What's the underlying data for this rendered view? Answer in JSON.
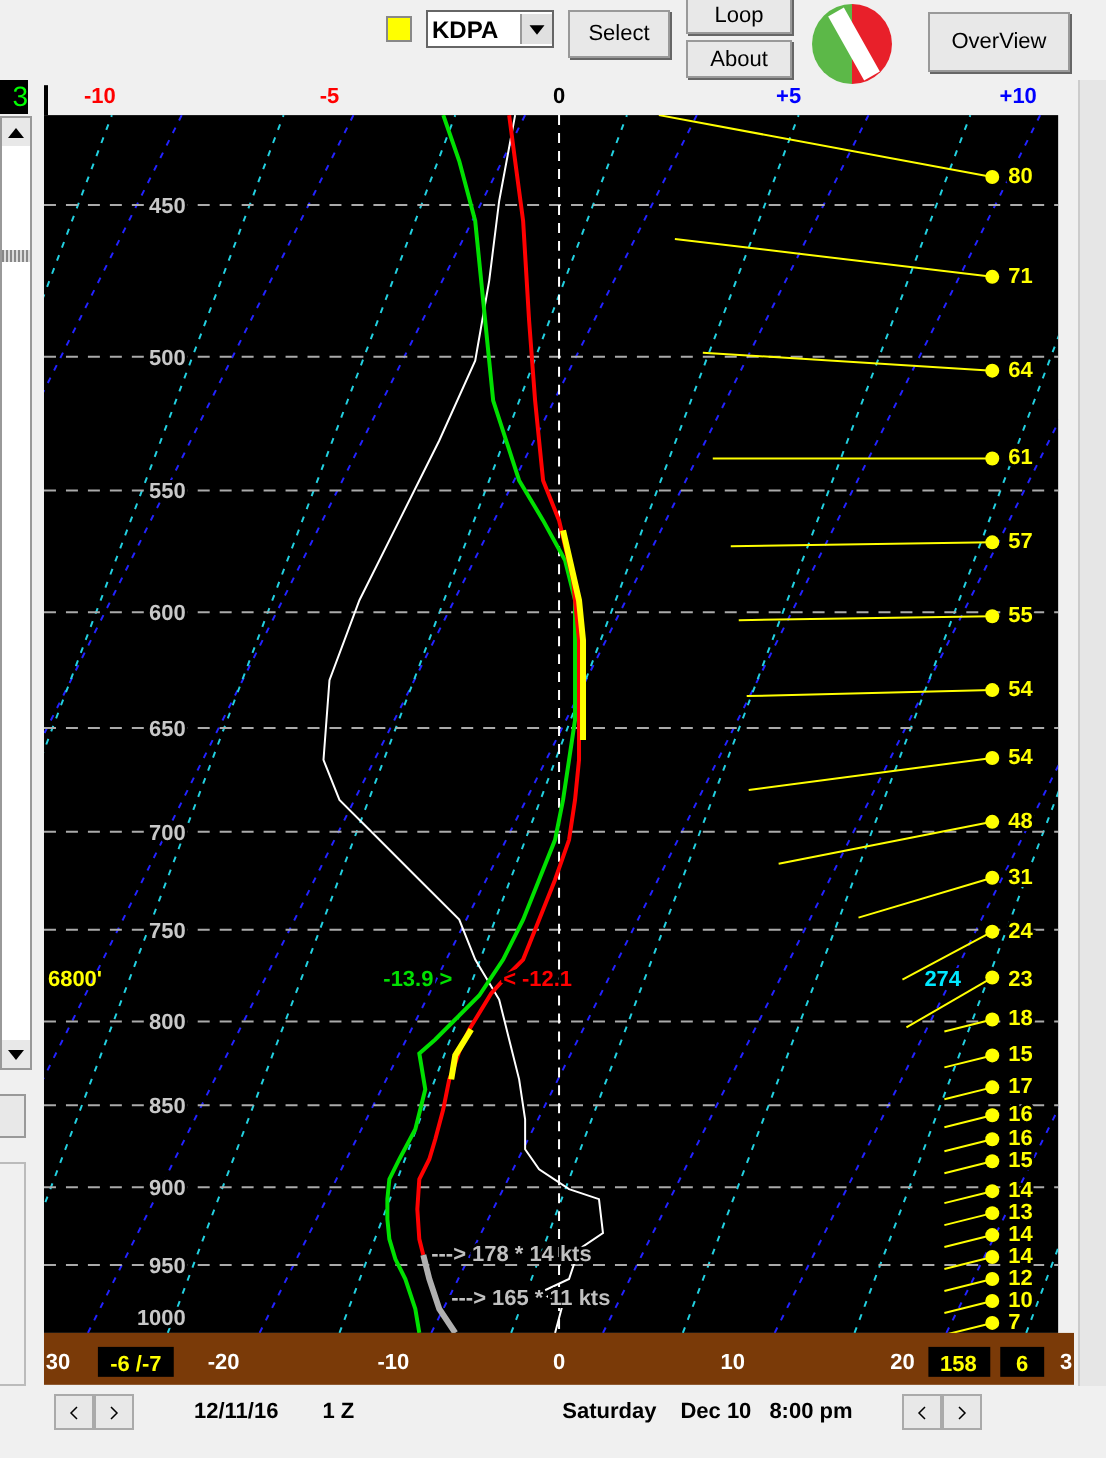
{
  "toolbar": {
    "station": "KDPA",
    "buttons": [
      {
        "label": "Select",
        "kind": "single"
      },
      {
        "label": "Loop",
        "kind": "stack"
      },
      {
        "label": "About",
        "kind": "stack"
      },
      {
        "label": "OverView",
        "kind": "wide"
      }
    ]
  },
  "sidebar": {
    "counter": "3"
  },
  "chart": {
    "top_scale": [
      {
        "label": "-10",
        "color": "#ff0000"
      },
      {
        "label": "-5",
        "color": "#ff0000"
      },
      {
        "label": "0",
        "color": "#000000"
      },
      {
        "label": "+5",
        "color": "#0000ff"
      },
      {
        "label": "+10",
        "color": "#0000ff"
      }
    ],
    "pressure_labels": [
      "450",
      "500",
      "550",
      "600",
      "650",
      "700",
      "750",
      "800",
      "850",
      "900",
      "950",
      "1000"
    ],
    "temperature_labels": [
      "30",
      "-20",
      "-10",
      "0",
      "10",
      "20",
      "3"
    ],
    "height_label": "6800'",
    "parcel_temp": "-13.9 >",
    "env_temp": "< -12.1",
    "wind_direction": "274",
    "surface_winds": [
      "---> 178 * 14 kts",
      "---> 165 * 11 kts"
    ],
    "wind_speeds": [
      "80",
      "71",
      "64",
      "61",
      "57",
      "55",
      "54",
      "54",
      "48",
      "31",
      "24",
      "23",
      "18",
      "15",
      "17",
      "16",
      "16",
      "15",
      "14",
      "13",
      "14",
      "14",
      "12",
      "10",
      "7"
    ],
    "surface_temps": "-6 /-7",
    "surface_direction": "158",
    "surface_speed": "6"
  },
  "status_bar": {
    "date": "12/11/16",
    "hour": "1 Z",
    "day": "Saturday",
    "date_long": "Dec 10",
    "time": "8:00 pm"
  }
}
